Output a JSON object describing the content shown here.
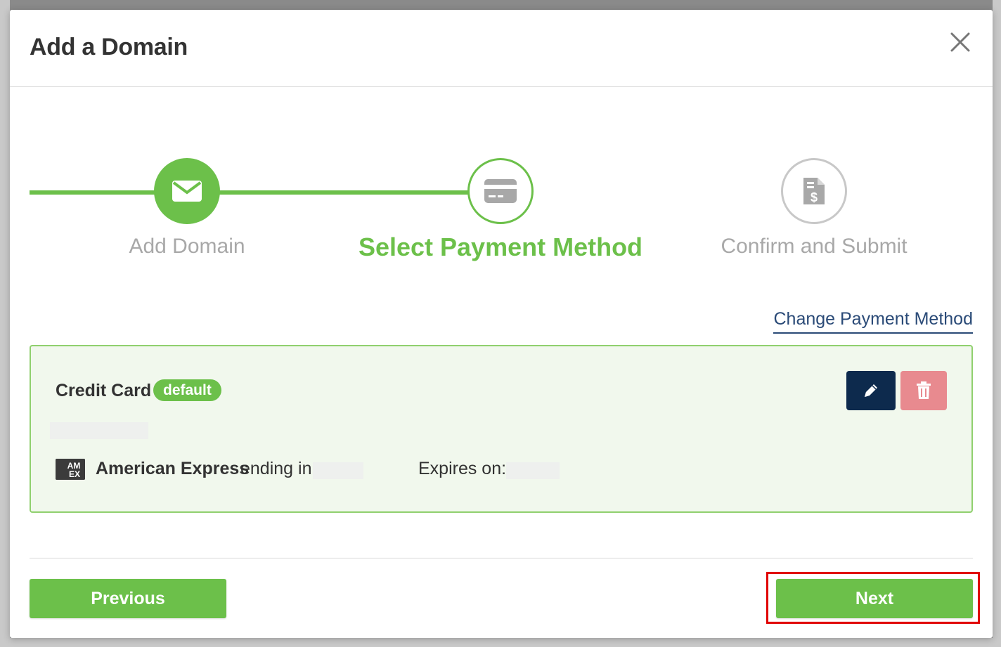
{
  "modal": {
    "title": "Add a Domain",
    "close_icon": "close-icon"
  },
  "stepper": {
    "steps": [
      {
        "label": "Add Domain",
        "icon": "envelope-icon",
        "state": "completed"
      },
      {
        "label": "Select Payment Method",
        "icon": "credit-card-icon",
        "state": "active"
      },
      {
        "label": "Confirm and Submit",
        "icon": "invoice-dollar-icon",
        "state": "pending"
      }
    ]
  },
  "payment": {
    "change_link": "Change Payment Method",
    "card": {
      "type": "Credit Card",
      "badge": "default",
      "brand_icon": "amex-icon",
      "brand": "American Express",
      "ending_text": "ending in",
      "expires_label": "Expires on:"
    },
    "edit_icon": "pencil-icon",
    "delete_icon": "trash-icon"
  },
  "footer": {
    "previous_label": "Previous",
    "next_label": "Next"
  },
  "colors": {
    "accent_green": "#6cc04a",
    "navy": "#0d2a4d",
    "danger_soft": "#e88a8f",
    "link_blue": "#2a4a77",
    "highlight_red": "#e00000"
  }
}
